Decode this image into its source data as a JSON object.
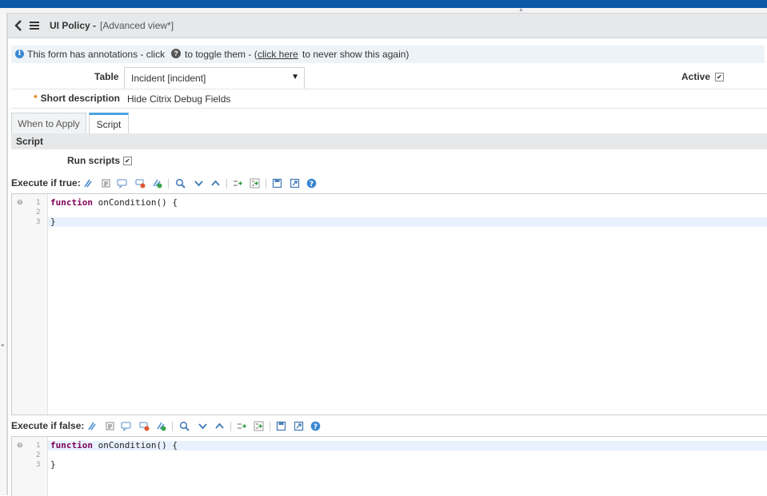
{
  "header": {
    "title": "UI Policy -",
    "view_label": "[Advanced view*]"
  },
  "annotation": {
    "text_before": "This form has annotations - click",
    "text_middle": "to toggle them - (",
    "link": "click here",
    "text_after": "to never show this again)"
  },
  "form": {
    "table_label": "Table",
    "table_value": "Incident [incident]",
    "active_label": "Active",
    "short_description_label": "Short description",
    "short_description_value": "Hide Citrix Debug Fields"
  },
  "tabs": [
    {
      "label": "When to Apply"
    },
    {
      "label": "Script"
    }
  ],
  "section": {
    "title": "Script",
    "run_scripts_label": "Run scripts"
  },
  "execute_true": {
    "label": "Execute if true:",
    "lines": [
      "1",
      "2",
      "3"
    ],
    "code_kw": "function",
    "code_rest": " onCondition() {",
    "code_close": "}"
  },
  "execute_false": {
    "label": "Execute if false:",
    "lines": [
      "1",
      "2",
      "3"
    ],
    "code_kw": "function",
    "code_rest": " onCondition() {",
    "code_close": "}"
  },
  "icons": {
    "toolbar": [
      "format-icon",
      "comment-icon",
      "comment-bubble-icon",
      "comment-remove-icon",
      "check-syntax-icon",
      "search-icon",
      "find-next-icon",
      "find-previous-icon",
      "replace-icon",
      "replace-all-icon",
      "save-icon",
      "fullscreen-icon",
      "help-icon"
    ]
  },
  "colors": {
    "accent": "#0b5aa8",
    "tab_active": "#4aa3df",
    "keyword": "#7f0055"
  }
}
